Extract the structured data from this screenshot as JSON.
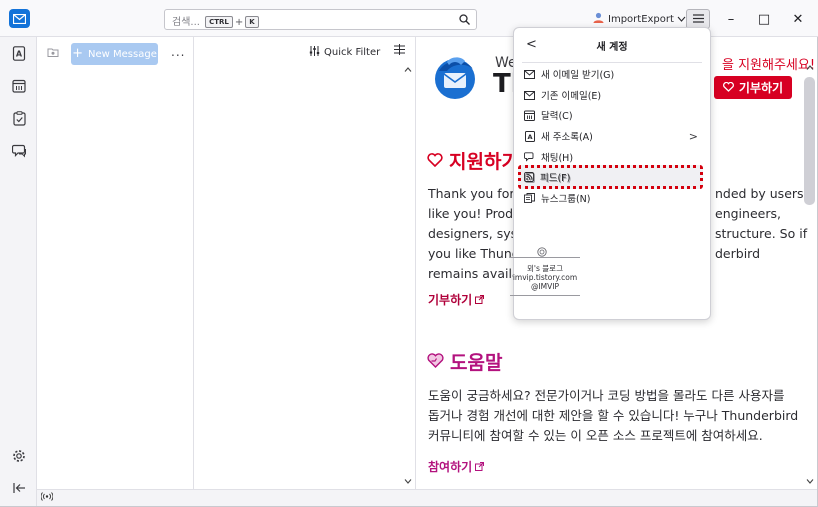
{
  "titlebar": {
    "search_placeholder": "검색...",
    "search_key1": "CTRL",
    "search_plus": "+",
    "search_key2": "K",
    "account_label": "ImportExport",
    "minimize": "–",
    "maximize": "□",
    "close": "✕"
  },
  "folder_pane": {
    "new_message_label": "New Message",
    "more_label": "..."
  },
  "thread_pane": {
    "quick_filter_label": "Quick Filter"
  },
  "content": {
    "hero_we": "We",
    "hero_th": "Th",
    "support_top": "을 지원해주세요!",
    "donate_button": "기부하기",
    "support_heading": "지원하기",
    "support_lines": [
      {
        "left": "Thank you for s",
        "right": "nded by users"
      },
      {
        "left": "like you! Produ",
        "right": "engineers,"
      },
      {
        "left": "designers, syst",
        "right": "structure. So if"
      },
      {
        "left": "you like Thunde",
        "right": "derbird"
      },
      {
        "left": "remains availab",
        "right": ""
      }
    ],
    "support_link": "기부하기",
    "help_heading": "도움말",
    "help_lines": [
      "도움이 궁금하세요? 전문가이거나 코딩 방법을 몰라도 다른 사용자를",
      "돕거나 경험 개선에 대한 제안을 할 수 있습니다! 누구나 Thunderbird",
      "커뮤니티에 참여할 수 있는 이 오픈 소스 프로젝트에 참여하세요."
    ],
    "help_link": "참여하기"
  },
  "app_menu": {
    "back_label": "<",
    "title": "새 계정",
    "items": [
      {
        "label": "새 이메일 받기(G)",
        "icon": "mail-icon"
      },
      {
        "label": "기존 이메일(E)",
        "icon": "mail-icon"
      },
      {
        "label": "달력(C)",
        "icon": "calendar-icon"
      },
      {
        "label": "새 주소록(A)",
        "icon": "address-book-icon",
        "submenu": true
      },
      {
        "label": "채팅(H)",
        "icon": "chat-icon"
      },
      {
        "label": "피드(F)",
        "icon": "rss-icon"
      },
      {
        "label": "뉴스그룹(N)",
        "icon": "newsgroup-icon"
      }
    ],
    "submenu_chevron": ">"
  },
  "watermark": {
    "line1": "뫼's 블로그",
    "line2": "imvip.tistory.com",
    "line3": "@IMVIP"
  },
  "colors": {
    "accent": "#1373d9",
    "donate_red": "#d70022",
    "help_magenta": "#b3127e",
    "highlight_red": "#d4000d"
  }
}
